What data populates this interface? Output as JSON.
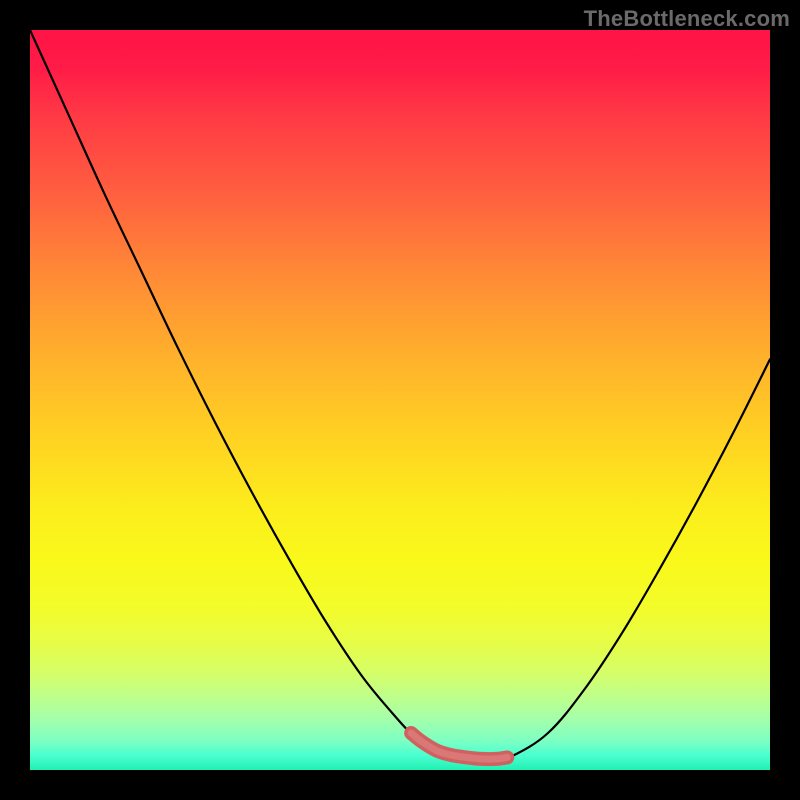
{
  "attribution": "TheBottleneck.com",
  "chart_data": {
    "type": "line",
    "title": "",
    "xlabel": "",
    "ylabel": "",
    "xlim": [
      0,
      100
    ],
    "ylim": [
      0,
      100
    ],
    "grid": false,
    "legend": false,
    "note": "Axes are unlabeled; values are normalized 0–100 estimated from pixel positions.",
    "series": [
      {
        "name": "curve",
        "color": "#000000",
        "x": [
          0,
          5,
          10,
          15,
          20,
          25,
          30,
          35,
          40,
          45,
          50,
          51.5,
          53,
          55,
          60,
          63,
          65,
          70,
          75,
          80,
          85,
          90,
          95,
          100
        ],
        "y": [
          100,
          89,
          78,
          67.5,
          57,
          47,
          37.5,
          28.5,
          20,
          12.5,
          6.5,
          5,
          3.8,
          2.6,
          1.5,
          1.5,
          1.8,
          5,
          11,
          18.5,
          27,
          36,
          45.5,
          55.5
        ]
      },
      {
        "name": "highlight-band",
        "color": "#d46a6a",
        "style": "thick",
        "x": [
          51.5,
          53,
          55,
          57,
          59,
          61,
          63,
          64.5
        ],
        "y": [
          5,
          3.8,
          2.6,
          2,
          1.7,
          1.5,
          1.5,
          1.7
        ]
      }
    ],
    "gradient_stops": [
      {
        "pos": 0,
        "color": "#ff1446"
      },
      {
        "pos": 50,
        "color": "#ffd222"
      },
      {
        "pos": 100,
        "color": "#21f0b4"
      }
    ]
  }
}
